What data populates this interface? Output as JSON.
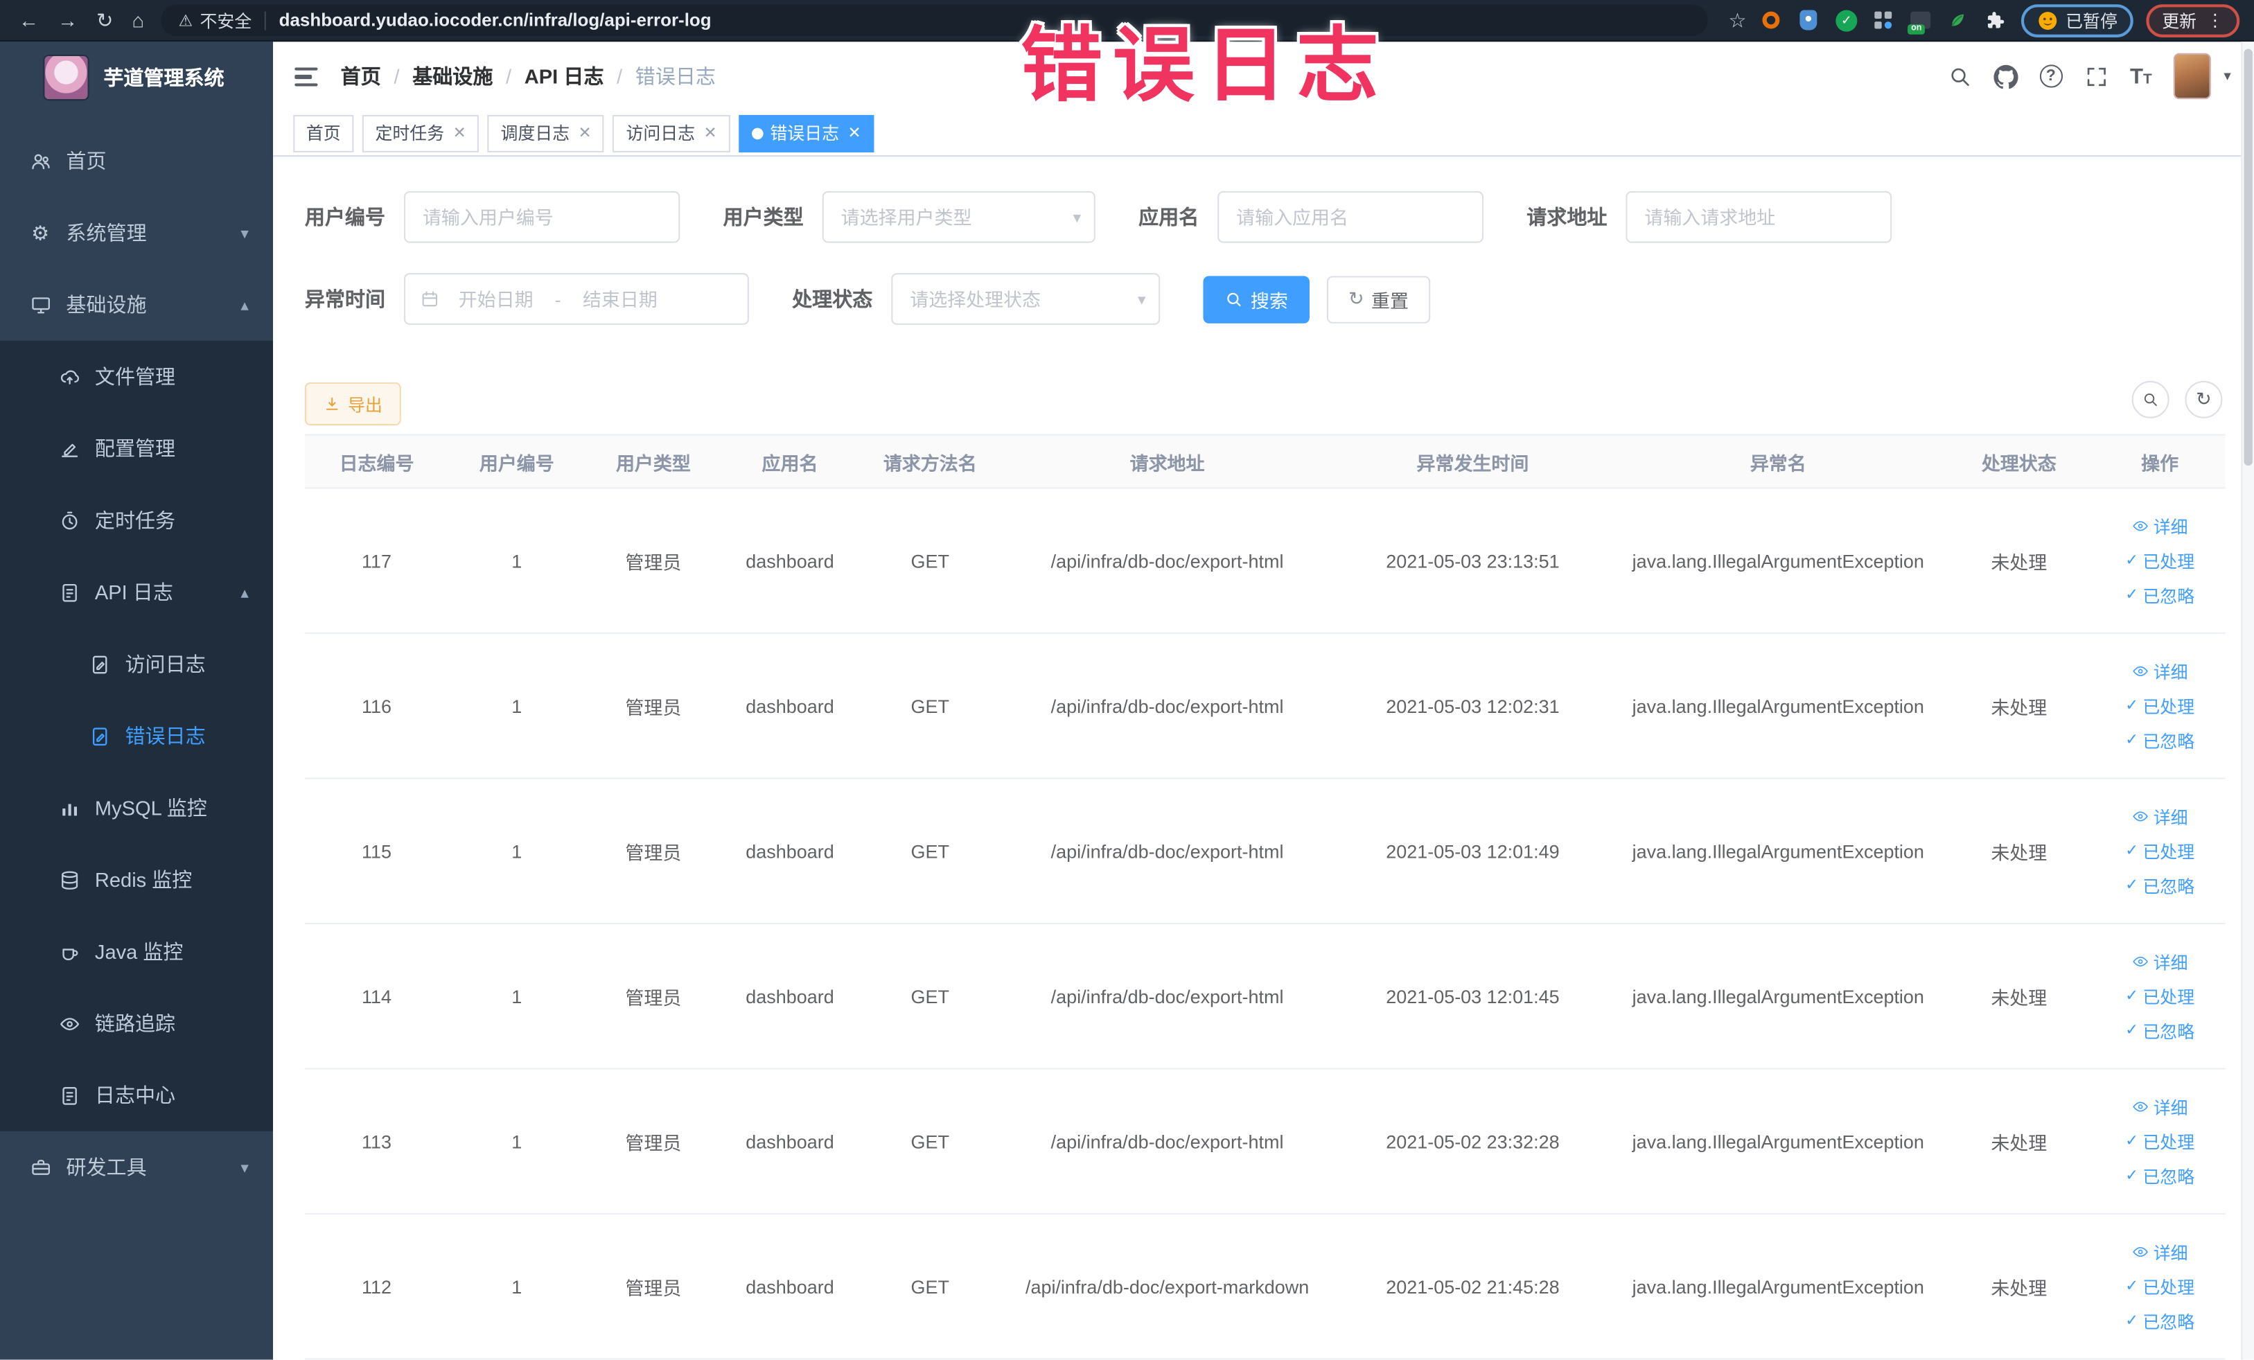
{
  "annotation": {
    "text": "错误日志"
  },
  "browser": {
    "security_label": "不安全",
    "url": "dashboard.yudao.iocoder.cn/infra/log/api-error-log",
    "extension_badge": "on",
    "paused_badge": "已暂停",
    "update_button": "更新"
  },
  "sidebar": {
    "title": "芋道管理系统",
    "items": [
      {
        "label": "首页"
      },
      {
        "label": "系统管理"
      },
      {
        "label": "基础设施"
      },
      {
        "label": "文件管理"
      },
      {
        "label": "配置管理"
      },
      {
        "label": "定时任务"
      },
      {
        "label": "API 日志"
      },
      {
        "label": "访问日志"
      },
      {
        "label": "错误日志"
      },
      {
        "label": "MySQL 监控"
      },
      {
        "label": "Redis 监控"
      },
      {
        "label": "Java 监控"
      },
      {
        "label": "链路追踪"
      },
      {
        "label": "日志中心"
      },
      {
        "label": "研发工具"
      }
    ]
  },
  "breadcrumb": {
    "separator": "/",
    "items": [
      "首页",
      "基础设施",
      "API 日志",
      "错误日志"
    ]
  },
  "tabs": [
    {
      "label": "首页"
    },
    {
      "label": "定时任务"
    },
    {
      "label": "调度日志"
    },
    {
      "label": "访问日志"
    },
    {
      "label": "错误日志"
    }
  ],
  "filters": {
    "user_id": {
      "label": "用户编号",
      "placeholder": "请输入用户编号"
    },
    "user_type": {
      "label": "用户类型",
      "placeholder": "请选择用户类型"
    },
    "app_name": {
      "label": "应用名",
      "placeholder": "请输入应用名"
    },
    "request_url": {
      "label": "请求地址",
      "placeholder": "请输入请求地址"
    },
    "exception_time": {
      "label": "异常时间",
      "start_placeholder": "开始日期",
      "separator": "-",
      "end_placeholder": "结束日期"
    },
    "process_status": {
      "label": "处理状态",
      "placeholder": "请选择处理状态"
    },
    "search_button": "搜索",
    "reset_button": "重置"
  },
  "toolbar": {
    "export_button": "导出"
  },
  "table": {
    "columns": [
      "日志编号",
      "用户编号",
      "用户类型",
      "应用名",
      "请求方法名",
      "请求地址",
      "异常发生时间",
      "异常名",
      "处理状态",
      "操作"
    ],
    "actions": {
      "detail": "详细",
      "processed": "已处理",
      "ignored": "已忽略"
    },
    "rows": [
      {
        "id": "117",
        "user_id": "1",
        "user_type": "管理员",
        "app": "dashboard",
        "method": "GET",
        "url": "/api/infra/db-doc/export-html",
        "time": "2021-05-03 23:13:51",
        "exception": "java.lang.IllegalArgumentException",
        "status": "未处理"
      },
      {
        "id": "116",
        "user_id": "1",
        "user_type": "管理员",
        "app": "dashboard",
        "method": "GET",
        "url": "/api/infra/db-doc/export-html",
        "time": "2021-05-03 12:02:31",
        "exception": "java.lang.IllegalArgumentException",
        "status": "未处理"
      },
      {
        "id": "115",
        "user_id": "1",
        "user_type": "管理员",
        "app": "dashboard",
        "method": "GET",
        "url": "/api/infra/db-doc/export-html",
        "time": "2021-05-03 12:01:49",
        "exception": "java.lang.IllegalArgumentException",
        "status": "未处理"
      },
      {
        "id": "114",
        "user_id": "1",
        "user_type": "管理员",
        "app": "dashboard",
        "method": "GET",
        "url": "/api/infra/db-doc/export-html",
        "time": "2021-05-03 12:01:45",
        "exception": "java.lang.IllegalArgumentException",
        "status": "未处理"
      },
      {
        "id": "113",
        "user_id": "1",
        "user_type": "管理员",
        "app": "dashboard",
        "method": "GET",
        "url": "/api/infra/db-doc/export-html",
        "time": "2021-05-02 23:32:28",
        "exception": "java.lang.IllegalArgumentException",
        "status": "未处理"
      },
      {
        "id": "112",
        "user_id": "1",
        "user_type": "管理员",
        "app": "dashboard",
        "method": "GET",
        "url": "/api/infra/db-doc/export-markdown",
        "time": "2021-05-02 21:45:28",
        "exception": "java.lang.IllegalArgumentException",
        "status": "未处理"
      }
    ]
  },
  "colors": {
    "accent": "#409eff",
    "warning": "#e6a23c",
    "annotation_pink": "#f0335f",
    "sidebar_bg": "#304156",
    "submenu_bg": "#1f2d3d",
    "chrome_bg": "#1d2834"
  }
}
